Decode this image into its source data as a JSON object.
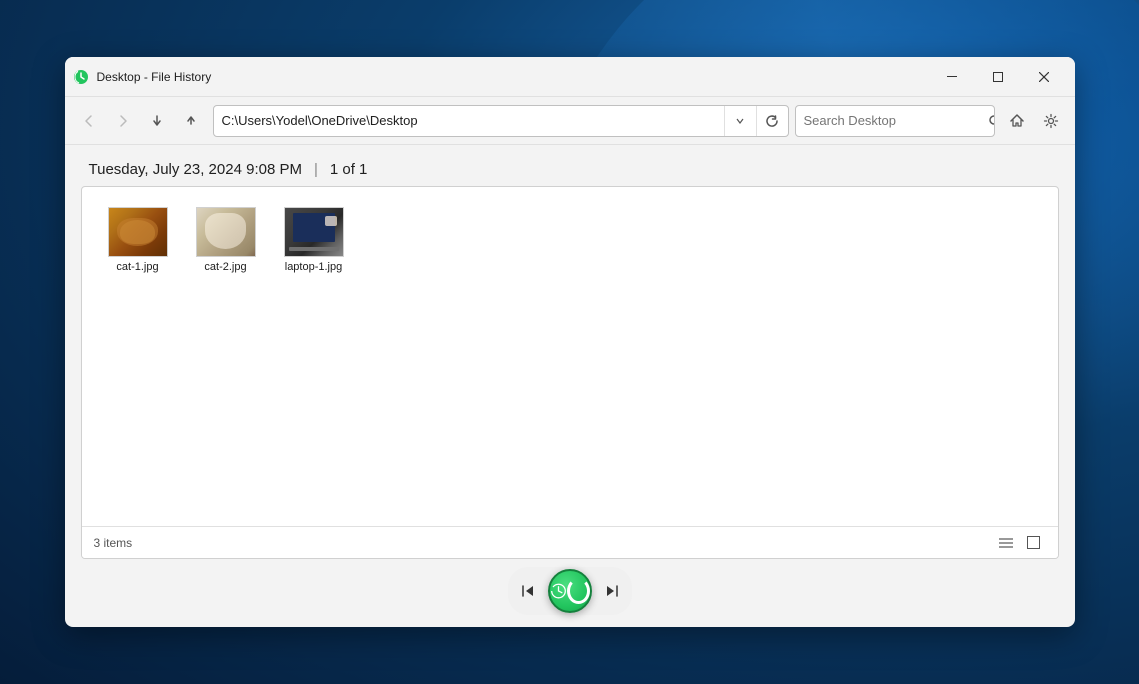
{
  "window": {
    "title": "Desktop - File History",
    "icon": "file-history-icon"
  },
  "title_bar": {
    "title": "Desktop - File History",
    "minimize_label": "−",
    "restore_label": "□",
    "close_label": "✕"
  },
  "toolbar": {
    "back_disabled": true,
    "forward_disabled": true,
    "up_label": "↑",
    "address": "C:\\Users\\Yodel\\OneDrive\\Desktop",
    "refresh_label": "↻",
    "search_placeholder": "Search Desktop",
    "home_label": "⌂",
    "settings_label": "⚙"
  },
  "content": {
    "date": "Tuesday, July 23, 2024 9:08 PM",
    "separator": "|",
    "version": "1 of 1",
    "files": [
      {
        "name": "cat-1.jpg",
        "type": "cat1",
        "thumbnail_type": "cat1"
      },
      {
        "name": "cat-2.jpg",
        "type": "cat2",
        "thumbnail_type": "cat2"
      },
      {
        "name": "laptop-1.jpg",
        "type": "laptop",
        "thumbnail_type": "laptop"
      }
    ],
    "items_count": "3 items"
  },
  "status_bar": {
    "items_count": "3 items",
    "list_view_icon": "≡",
    "grid_view_icon": "□"
  },
  "bottom_nav": {
    "first_label": "⏮",
    "last_label": "⏭"
  }
}
